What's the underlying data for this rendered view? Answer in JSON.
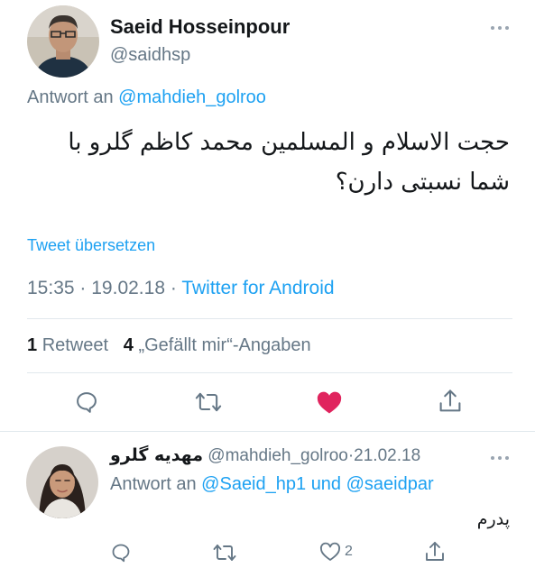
{
  "main_tweet": {
    "author_name": "Saeid Hosseinpour",
    "author_handle": "@saidhsp",
    "reply_prefix": "Antwort an",
    "reply_to": "@mahdieh_golroo",
    "text_line1": "حجت الاسلام و المسلمین محمد کاظم گلرو با",
    "text_line2": "شما نسبتی دارن؟",
    "translate_label": "Tweet übersetzen",
    "time": "15:35",
    "date": "19.02.18",
    "separator": "·",
    "source": "Twitter for Android",
    "retweet_count": "1",
    "retweet_label": "Retweet",
    "like_count": "4",
    "like_label": "„Gefällt mir“-Angaben"
  },
  "reply_tweet": {
    "author_name": "مهدیه گلرو",
    "author_handle": "@mahdieh_golroo",
    "separator": "·",
    "date": "21.02.18",
    "reply_prefix": "Antwort an",
    "mention1": "@Saeid_hp1",
    "conjunction": "und",
    "mention2": "@saeidpar",
    "text": "پدرم",
    "like_count": "2"
  },
  "colors": {
    "accent": "#1da1f2",
    "like_active": "#e0245e",
    "secondary_text": "#657786",
    "divider": "#e1e8ed"
  },
  "icons": [
    "reply-icon",
    "retweet-icon",
    "like-icon",
    "share-icon",
    "more-icon"
  ]
}
